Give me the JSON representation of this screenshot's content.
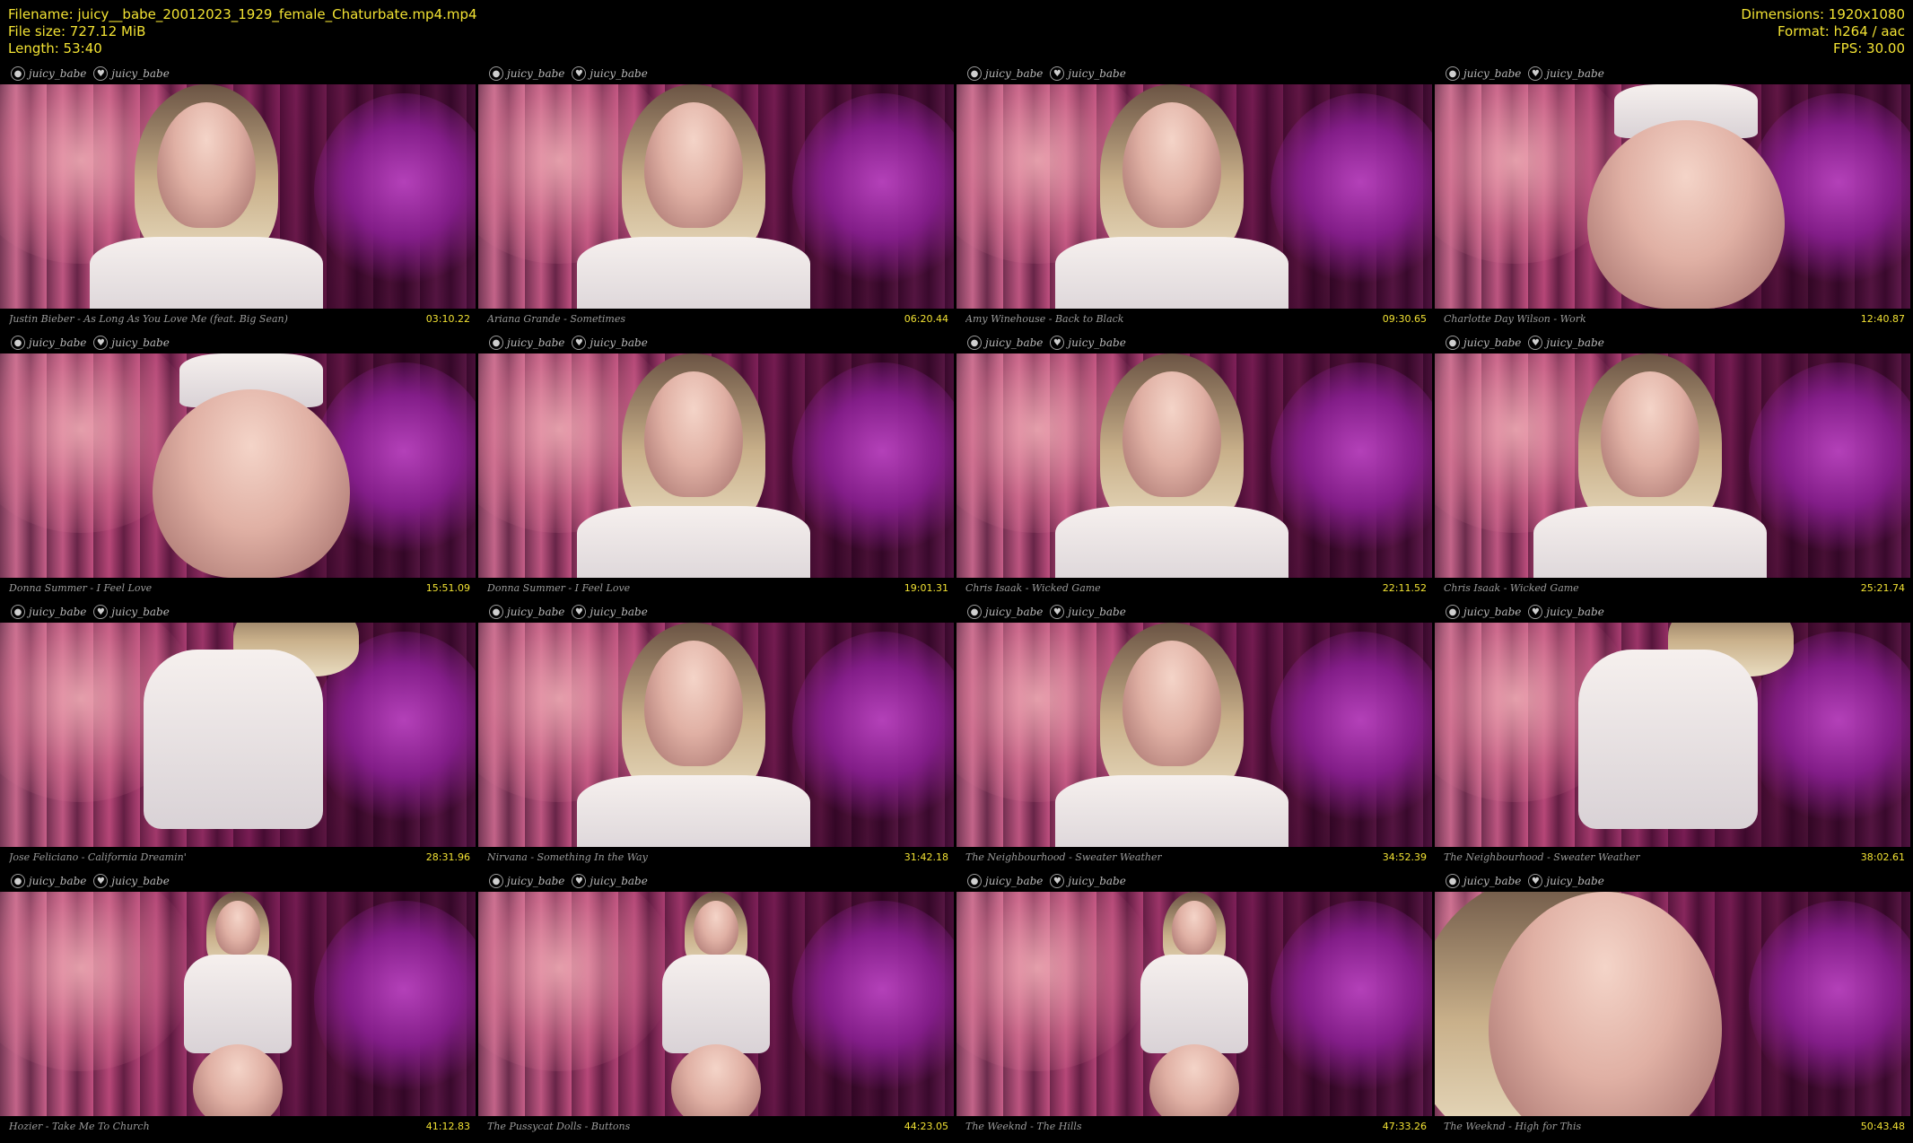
{
  "header": {
    "filename_label": "Filename: juicy__babe_20012023_1929_female_Chaturbate.mp4.mp4",
    "filesize_label": "File size: 727.12 MiB",
    "length_label": "Length: 53:40",
    "dimensions_label": "Dimensions: 1920x1080",
    "format_label": "Format: h264 / aac",
    "fps_label": "FPS: 30.00"
  },
  "watermark": {
    "twitter_handle": "juicy_babe",
    "onlyfans_handle": "juicy_babe",
    "twitter_icon": "twitter-bird-icon",
    "onlyfans_icon": "heart-lock-icon"
  },
  "colors": {
    "header_text": "#f2e233",
    "timestamp_text": "#f2e233",
    "caption_text": "#9a9a9a"
  },
  "thumbnails": [
    {
      "song": "Justin Bieber - As Long As You Love Me (feat. Big Sean)",
      "time": "03:10.22",
      "scene": "face-right"
    },
    {
      "song": "Ariana Grande - Sometimes",
      "time": "06:20.44",
      "scene": "face-center"
    },
    {
      "song": "Amy Winehouse - Back to Black",
      "time": "09:30.65",
      "scene": "face-center"
    },
    {
      "song": "Charlotte Day Wilson - Work",
      "time": "12:40.87",
      "scene": "back"
    },
    {
      "song": "Donna Summer - I Feel Love",
      "time": "15:51.09",
      "scene": "back"
    },
    {
      "song": "Donna Summer - I Feel Love",
      "time": "19:01.31",
      "scene": "face-center"
    },
    {
      "song": "Chris Isaak - Wicked Game",
      "time": "22:11.52",
      "scene": "face-center"
    },
    {
      "song": "Chris Isaak - Wicked Game",
      "time": "25:21.74",
      "scene": "face-center"
    },
    {
      "song": "Jose Feliciano - California Dreamin'",
      "time": "28:31.96",
      "scene": "torso"
    },
    {
      "song": "Nirvana - Something In the Way",
      "time": "31:42.18",
      "scene": "face-center"
    },
    {
      "song": "The Neighbourhood - Sweater Weather",
      "time": "34:52.39",
      "scene": "face-center"
    },
    {
      "song": "The Neighbourhood - Sweater Weather",
      "time": "38:02.61",
      "scene": "torso"
    },
    {
      "song": "Hozier - Take Me To Church",
      "time": "41:12.83",
      "scene": "standing"
    },
    {
      "song": "The Pussycat Dolls - Buttons",
      "time": "44:23.05",
      "scene": "standing"
    },
    {
      "song": "The Weeknd - The Hills",
      "time": "47:33.26",
      "scene": "standing"
    },
    {
      "song": "The Weeknd - High for This",
      "time": "50:43.48",
      "scene": "closeup"
    }
  ]
}
